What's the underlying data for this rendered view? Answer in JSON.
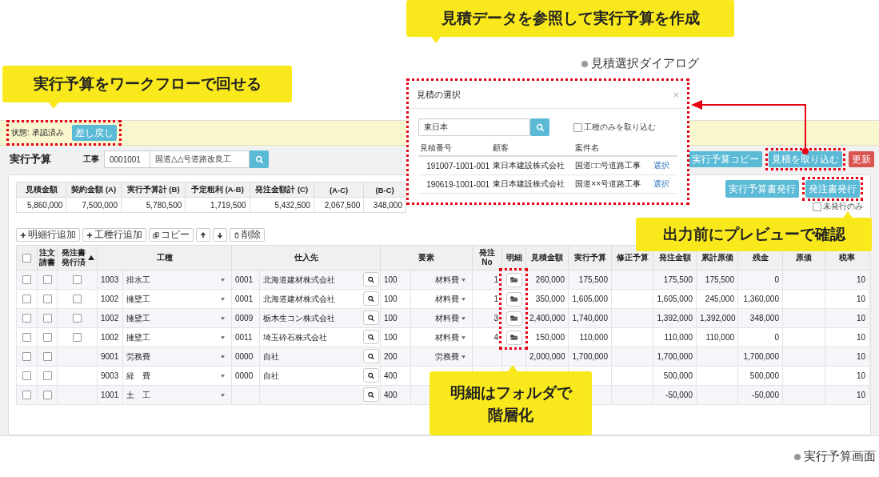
{
  "callouts": [
    {
      "text": "実行予算をワークフローで回せる"
    },
    {
      "text": "見積データを参照して実行予算を作成"
    },
    {
      "text": "出力前にプレビューで確認"
    },
    {
      "text": "明細はフォルダで階層化"
    }
  ],
  "captions": [
    "見積選択ダイアログ",
    "実行予算画面"
  ],
  "status_bar": {
    "label": "状態: 承認済み",
    "button": "差し戻し",
    "highlighted": true
  },
  "header": {
    "title": "実行予算",
    "project_label": "工事",
    "project_code": "0001001",
    "project_name": "国道△△号道路改良工",
    "buttons": [
      {
        "label": "実行予算コピー",
        "kind": "primary",
        "highlighted": false
      },
      {
        "label": "見積を取り込む",
        "kind": "primary",
        "highlighted": true
      },
      {
        "label": "更新",
        "kind": "danger",
        "highlighted": false
      }
    ]
  },
  "summary": {
    "columns": [
      "見積金額",
      "契約金額 (A)",
      "実行予算計 (B)",
      "予定粗利 (A-B)",
      "発注金額計 (C)",
      "(A-C)",
      "(B-C)"
    ],
    "values": [
      "5,860,000",
      "7,500,000",
      "5,780,500",
      "1,719,500",
      "5,432,500",
      "2,067,500",
      "348,000"
    ]
  },
  "output_buttons": [
    {
      "label": "実行予算書発行",
      "highlighted": false
    },
    {
      "label": "発注書発行",
      "highlighted": true
    }
  ],
  "unissued_only": {
    "label": "未発行のみ",
    "checked": false
  },
  "toolbar": [
    {
      "kind": "plus",
      "label": "明細行追加"
    },
    {
      "kind": "plus",
      "label": "工種行追加"
    },
    {
      "kind": "copy",
      "label": "コピー"
    },
    {
      "kind": "up"
    },
    {
      "kind": "down"
    },
    {
      "kind": "trash",
      "label": "削除"
    }
  ],
  "table": {
    "select_all": {
      "checked": false
    },
    "columns": [
      {
        "label": "注文請書"
      },
      {
        "label": "発注書発行済",
        "sorted": true
      },
      {
        "label": "工種"
      },
      {
        "label": "仕入先"
      },
      {
        "label": "要素"
      },
      {
        "label": "発注No"
      },
      {
        "label": "明細",
        "highlighted": true
      },
      {
        "label": "見積金額"
      },
      {
        "label": "実行予算"
      },
      {
        "label": "修正予算"
      },
      {
        "label": "発注金額"
      },
      {
        "label": "累計原価"
      },
      {
        "label": "残金"
      },
      {
        "label": "原価"
      },
      {
        "label": "税率"
      }
    ],
    "rows": [
      {
        "checked": false,
        "contract_checked": false,
        "issue_checked": false,
        "work_code": "1003",
        "work_name": "排水工",
        "supplier_code": "0001",
        "supplier_name": "北海道建材株式会社",
        "element_code": "100",
        "element_name": "材料費",
        "order_no": "1",
        "has_detail": true,
        "estimate": "260,000",
        "budget": "175,500",
        "order_amount": "175,500",
        "cost_total": "175,500",
        "balance": "0",
        "tax": "10"
      },
      {
        "checked": false,
        "contract_checked": false,
        "issue_checked": false,
        "work_code": "1002",
        "work_name": "擁壁工",
        "supplier_code": "0001",
        "supplier_name": "北海道建材株式会社",
        "element_code": "100",
        "element_name": "材料費",
        "order_no": "1",
        "has_detail": true,
        "estimate": "350,000",
        "budget": "1,605,000",
        "order_amount": "1,605,000",
        "cost_total": "245,000",
        "balance": "1,360,000",
        "tax": "10"
      },
      {
        "checked": false,
        "contract_checked": false,
        "issue_checked": false,
        "work_code": "1002",
        "work_name": "擁壁工",
        "supplier_code": "0009",
        "supplier_name": "栃木生コン株式会社",
        "element_code": "100",
        "element_name": "材料費",
        "order_no": "3",
        "has_detail": true,
        "estimate": "2,400,000",
        "budget": "1,740,000",
        "order_amount": "1,392,000",
        "cost_total": "1,392,000",
        "balance": "348,000",
        "tax": "10"
      },
      {
        "checked": false,
        "contract_checked": false,
        "issue_checked": false,
        "work_code": "1002",
        "work_name": "擁壁工",
        "supplier_code": "0011",
        "supplier_name": "埼玉砕石株式会社",
        "element_code": "100",
        "element_name": "材料費",
        "order_no": "4",
        "has_detail": true,
        "estimate": "150,000",
        "budget": "110,000",
        "order_amount": "110,000",
        "cost_total": "110,000",
        "balance": "0",
        "tax": "10"
      },
      {
        "checked": false,
        "contract_checked": false,
        "work_code": "9001",
        "work_name": "労務費",
        "supplier_code": "0000",
        "supplier_name": "自社",
        "element_code": "200",
        "element_name": "労務費",
        "has_detail": false,
        "estimate": "2,000,000",
        "budget": "1,700,000",
        "order_amount": "1,700,000",
        "balance": "1,700,000",
        "tax": "10"
      },
      {
        "checked": false,
        "contract_checked": false,
        "work_code": "9003",
        "work_name": "経　費",
        "supplier_code": "0000",
        "supplier_name": "自社",
        "element_code": "400",
        "has_detail": false,
        "order_amount": "500,000",
        "balance": "500,000",
        "tax": "10"
      },
      {
        "checked": false,
        "contract_checked": false,
        "work_code": "1001",
        "work_name": "土　工",
        "element_code": "400",
        "has_detail": false,
        "order_amount": "-50,000",
        "balance": "-50,000",
        "tax": "10"
      }
    ]
  },
  "dialog": {
    "title": "見積の選択",
    "highlighted": true,
    "search_value": "東日本",
    "option": {
      "label": "工種のみを取り込む",
      "checked": false
    },
    "columns": [
      "見積番号",
      "顧客",
      "案件名"
    ],
    "rows": [
      {
        "estimate_no": "191007-1001-001",
        "customer": "東日本建設株式会社",
        "project": "国道□□号道路工事",
        "action": "選択"
      },
      {
        "estimate_no": "190619-1001-001",
        "customer": "東日本建設株式会社",
        "project": "国道××号道路工事",
        "action": "選択"
      }
    ]
  }
}
